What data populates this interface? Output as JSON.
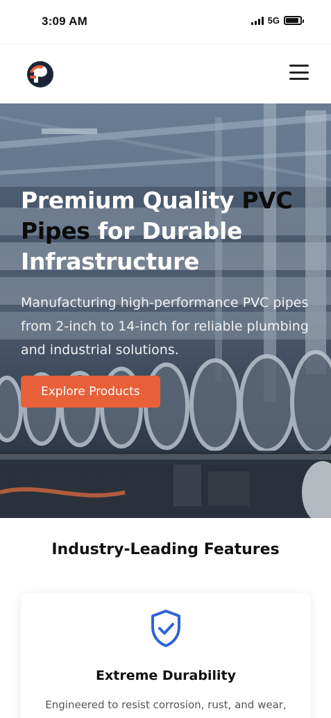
{
  "status_bar": {
    "time": "3:09 AM",
    "network": "5G",
    "battery_level": 0.9
  },
  "header": {
    "logo_icon": "brand-p-logo-icon",
    "menu_icon": "hamburger-menu-icon"
  },
  "hero": {
    "title_part1": "Premium Quality ",
    "title_accent": "PVC Pipes",
    "title_part2": " for Durable Infrastructure",
    "subtitle": "Manufacturing high-performance PVC pipes from 2-inch to 14-inch for reliable plumbing and industrial solutions.",
    "cta_label": "Explore Products"
  },
  "features": {
    "title": "Industry-Leading Features",
    "cards": [
      {
        "icon": "shield-check-icon",
        "title": "Extreme Durability",
        "description": "Engineered to resist corrosion, rust, and wear, ensuring long-lasting and reliable performance."
      }
    ]
  },
  "colors": {
    "accent": "#e8603a",
    "icon_blue": "#2f64d8",
    "logo_dark": "#1c2536"
  }
}
